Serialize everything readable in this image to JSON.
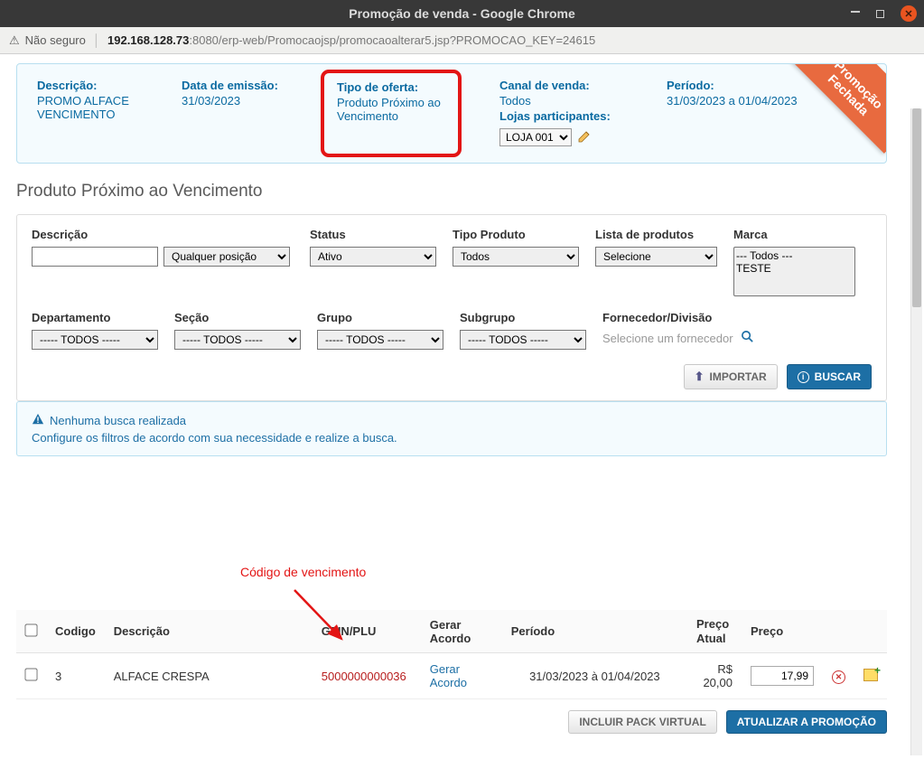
{
  "window": {
    "title": "Promoção de venda - Google Chrome"
  },
  "address": {
    "insecure_label": "Não seguro",
    "host": "192.168.128.73",
    "port_path": ":8080/erp-web/Promocaojsp/promocaoalterar5.jsp?PROMOCAO_KEY=24615"
  },
  "summary": {
    "descricao_label": "Descrição:",
    "descricao_val": "PROMO ALFACE VENCIMENTO",
    "emissao_label": "Data de emissão:",
    "emissao_val": "31/03/2023",
    "oferta_label": "Tipo de oferta:",
    "oferta_val": "Produto Próximo ao Vencimento",
    "canal_label": "Canal de venda:",
    "canal_val": "Todos",
    "lojas_label": "Lojas participantes:",
    "loja_selected": "LOJA 001",
    "periodo_label": "Período:",
    "periodo_val": "31/03/2023 a 01/04/2023",
    "ribbon_line1": "Promoção",
    "ribbon_line2": "Fechada"
  },
  "section": {
    "title": "Produto Próximo ao Vencimento"
  },
  "filters": {
    "descricao_label": "Descrição",
    "descricao_val": "",
    "qualq_label": "Qualquer posição",
    "status_label": "Status",
    "status_val": "Ativo",
    "tipoprod_label": "Tipo Produto",
    "tipoprod_val": "Todos",
    "lista_label": "Lista de produtos",
    "lista_val": "Selecione",
    "marca_label": "Marca",
    "marca_opt1": "--- Todos ---",
    "marca_opt2": "TESTE",
    "dept_label": "Departamento",
    "dept_val": "----- TODOS -----",
    "secao_label": "Seção",
    "secao_val": "----- TODOS -----",
    "grupo_label": "Grupo",
    "grupo_val": "----- TODOS -----",
    "subgrupo_label": "Subgrupo",
    "subgrupo_val": "----- TODOS -----",
    "fornecedor_label": "Fornecedor/Divisão",
    "fornecedor_ph": "Selecione um fornecedor",
    "btn_importar": "IMPORTAR",
    "btn_buscar": "BUSCAR"
  },
  "infobox": {
    "title": "Nenhuma busca realizada",
    "body": "Configure os filtros de acordo com sua necessidade e realize a busca."
  },
  "annotation": {
    "label": "Código de vencimento"
  },
  "table": {
    "headers": {
      "codigo": "Codigo",
      "descricao": "Descrição",
      "gtin": "GTIN/PLU",
      "gerar": "Gerar Acordo",
      "periodo": "Período",
      "preco_atual_l1": "Preço",
      "preco_atual_l2": "Atual",
      "preco": "Preço"
    },
    "row": {
      "codigo": "3",
      "descricao": "ALFACE CRESPA",
      "gtin": "5000000000036",
      "gerar": "Gerar Acordo",
      "periodo": "31/03/2023 à 01/04/2023",
      "preco_atual": "R$ 20,00",
      "preco": "17,99"
    }
  },
  "bottom": {
    "btn_pack": "INCLUIR PACK VIRTUAL",
    "btn_atualizar": "ATUALIZAR A PROMOÇÃO"
  }
}
